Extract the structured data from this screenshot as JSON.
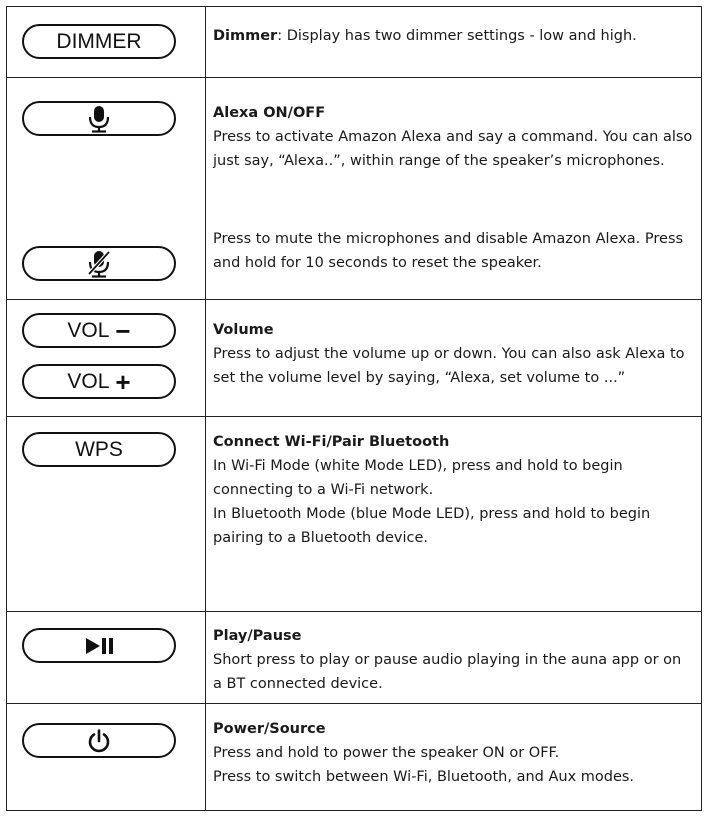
{
  "rows": {
    "dimmer": {
      "button": "DIMMER",
      "term": "Dimmer",
      "text": ": Display has two dimmer settings - low and high."
    },
    "alexa": {
      "button_icon": "microphone-icon",
      "button_icon_muted": "microphone-muted-icon",
      "title": "Alexa ON/OFF",
      "text": "Press to activate Amazon Alexa and say a command. You can also just say, “Alexa..”, within range of the speaker’s microphones.",
      "mute_text": "Press to mute the microphones and disable Amazon Alexa. Press and hold for 10 seconds to reset the speaker."
    },
    "volume": {
      "minus_label": "VOL",
      "minus_sign": "−",
      "plus_label": "VOL",
      "plus_sign": "+",
      "title": "Volume",
      "text": "Press to adjust the volume up or down. You can also ask Alexa to set the volume level by saying, “Alexa, set volume to ...”"
    },
    "wps": {
      "button": "WPS",
      "title": "Connect Wi-Fi/Pair Bluetooth",
      "line1": "In Wi-Fi Mode (white Mode LED), press and hold to begin connecting to a Wi-Fi network.",
      "line2": "In Bluetooth Mode (blue Mode LED), press and hold to begin",
      "line3": "pairing to a Bluetooth device."
    },
    "play": {
      "button_icon": "play-pause-icon",
      "title": "Play/Pause",
      "text": "Short press to play or pause audio playing in the auna app or on a BT connected device."
    },
    "power": {
      "button_icon": "power-icon",
      "title": "Power/Source",
      "line1": "Press and hold to power the speaker ON or OFF.",
      "line2": "Press to switch between Wi-Fi, Bluetooth, and Aux modes."
    }
  }
}
